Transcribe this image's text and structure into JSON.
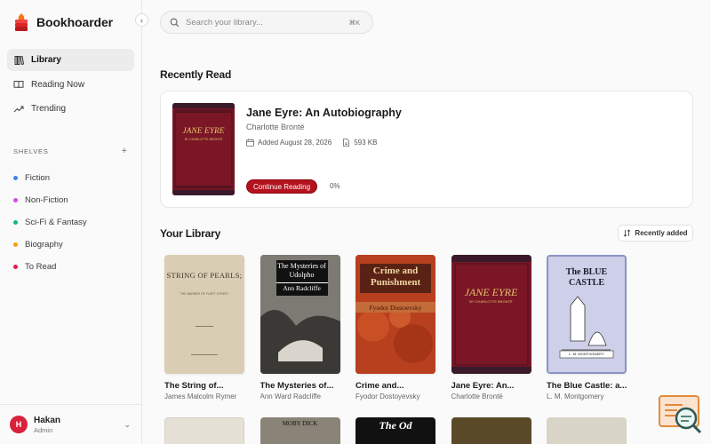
{
  "app": {
    "name": "Bookhoarder",
    "collapse_icon": "chevron-left-icon"
  },
  "nav": {
    "items": [
      {
        "label": "Library",
        "icon": "book-icon",
        "active": true
      },
      {
        "label": "Reading Now",
        "icon": "open-book-icon",
        "active": false
      },
      {
        "label": "Trending",
        "icon": "trending-up-icon",
        "active": false
      }
    ]
  },
  "shelves": {
    "title": "SHELVES",
    "add_label": "+",
    "items": [
      {
        "label": "Fiction",
        "color": "#3b82f6"
      },
      {
        "label": "Non-Fiction",
        "color": "#d946ef"
      },
      {
        "label": "Sci-Fi & Fantasy",
        "color": "#10b981"
      },
      {
        "label": "Biography",
        "color": "#f59e0b"
      },
      {
        "label": "To Read",
        "color": "#e11d48"
      }
    ]
  },
  "user": {
    "initial": "H",
    "name": "Hakan",
    "role": "Admin"
  },
  "search": {
    "placeholder": "Search your library...",
    "shortcut": "⌘K"
  },
  "recent": {
    "section_title": "Recently Read",
    "title": "Jane Eyre: An Autobiography",
    "author": "Charlotte Brontë",
    "added": "Added August 28, 2026",
    "size": "593 KB",
    "continue_label": "Continue Reading",
    "progress": "0%",
    "cover": {
      "title_text": "JANE EYRE",
      "sub_text": "BY CHARLOTTE BRONTË"
    }
  },
  "library": {
    "section_title": "Your Library",
    "sort_label": "Recently added",
    "books": [
      {
        "title": "The String of...",
        "author": "James Malcolm Rymer",
        "cover_text": "STRING OF PEARLS;",
        "cover_sub": "THE BARBER OF FLEET STREET"
      },
      {
        "title": "The Mysteries of...",
        "author": "Ann Ward Radcliffe",
        "cover_text": "The Mysteries of Udolpho",
        "cover_sub": "Ann Radcliffe"
      },
      {
        "title": "Crime and...",
        "author": "Fyodor Dostoyevsky",
        "cover_text": "Crime and Punishment",
        "cover_sub": "Fyodor Dostoevsky"
      },
      {
        "title": "Jane Eyre: An...",
        "author": "Charlotte Brontë",
        "cover_text": "JANE EYRE",
        "cover_sub": "BY CHARLOTTE BRONTË"
      },
      {
        "title": "The Blue Castle: a...",
        "author": "L. M. Montgomery",
        "cover_text": "The BLUE CASTLE",
        "cover_sub": "L. M. MONTGOMERY"
      }
    ],
    "row2_labels": [
      "",
      "MOBY DICK",
      "The Od",
      "",
      ""
    ]
  },
  "colors": {
    "accent": "#b3121e",
    "avatar": "#d8213b"
  }
}
